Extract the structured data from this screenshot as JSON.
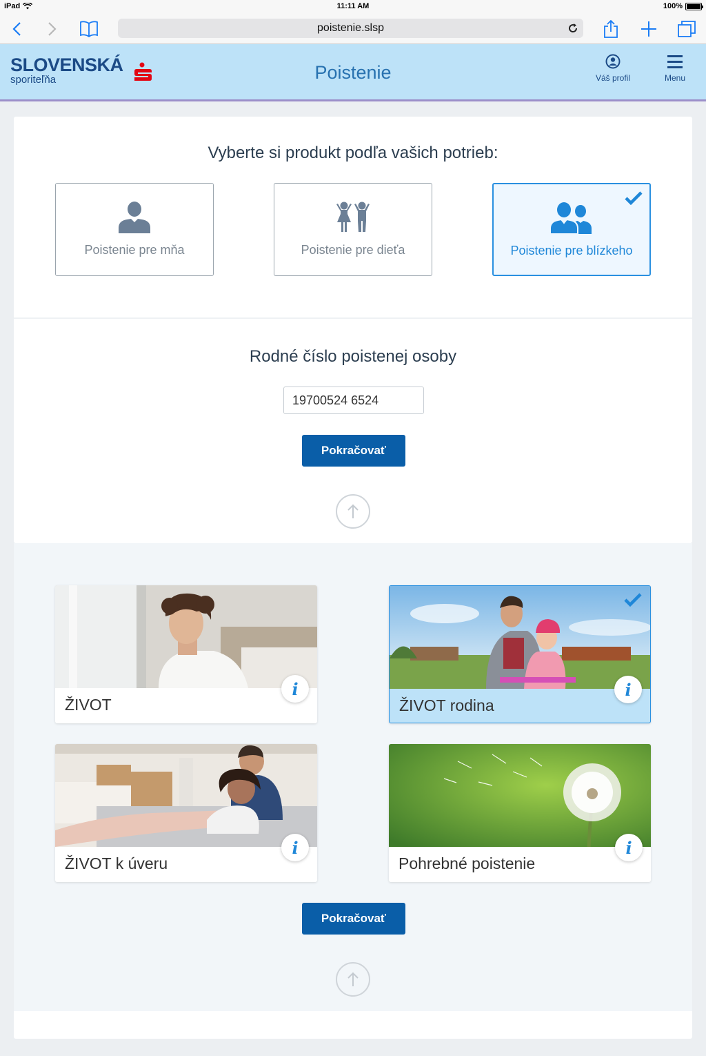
{
  "statusbar": {
    "device": "iPad",
    "time": "11:11 AM",
    "battery": "100%"
  },
  "browser": {
    "url": "poistenie.slsp"
  },
  "header": {
    "brand": "SLOVENSKÁ",
    "brand_sub": "sporiteľňa",
    "title": "Poistenie",
    "profile_label": "Váš profil",
    "menu_label": "Menu"
  },
  "selection": {
    "question": "Vyberte si produkt podľa vašich potrieb:",
    "options": [
      {
        "label": "Poistenie pre mňa",
        "icon": "person-icon",
        "selected": false
      },
      {
        "label": "Poistenie pre dieťa",
        "icon": "children-icon",
        "selected": false
      },
      {
        "label": "Poistenie pre blízkeho",
        "icon": "two-persons-icon",
        "selected": true
      }
    ]
  },
  "birth_number": {
    "label": "Rodné číslo poistenej osoby",
    "value": "19700524 6524"
  },
  "buttons": {
    "continue_label": "Pokračovať"
  },
  "products": [
    {
      "name": "ŽIVOT",
      "selected": false
    },
    {
      "name": "ŽIVOT rodina",
      "selected": true
    },
    {
      "name": "ŽIVOT k úveru",
      "selected": false
    },
    {
      "name": "Pohrebné poistenie",
      "selected": false
    }
  ],
  "colors": {
    "accent": "#1f87d8",
    "header_bg": "#bde2f8",
    "button": "#0a5ea8",
    "brand_red": "#e30613",
    "brand_blue": "#1b4a86"
  }
}
